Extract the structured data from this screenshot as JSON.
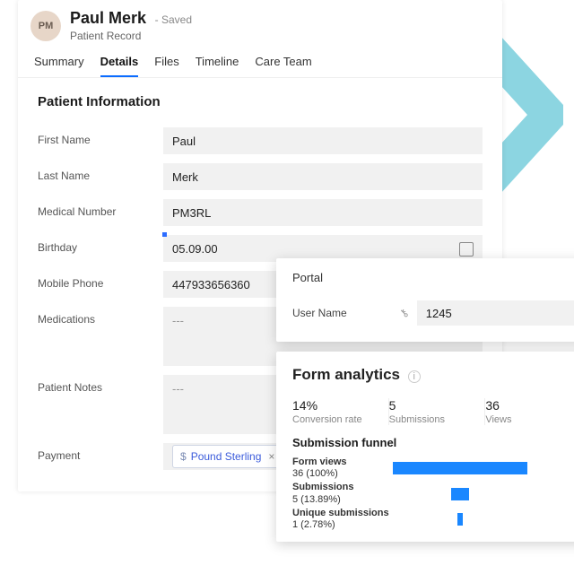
{
  "header": {
    "avatar_initials": "PM",
    "name": "Paul Merk",
    "save_status": "- Saved",
    "record_type": "Patient Record"
  },
  "tabs": [
    "Summary",
    "Details",
    "Files",
    "Timeline",
    "Care Team"
  ],
  "active_tab": 1,
  "section_title": "Patient Information",
  "fields": {
    "first_name": {
      "label": "First Name",
      "value": "Paul"
    },
    "last_name": {
      "label": "Last Name",
      "value": "Merk"
    },
    "medical_number": {
      "label": "Medical Number",
      "value": "PM3RL"
    },
    "birthday": {
      "label": "Birthday",
      "value": "05.09.00"
    },
    "mobile_phone": {
      "label": "Mobile Phone",
      "value": "447933656360"
    },
    "medications": {
      "label": "Medications",
      "value": "---"
    },
    "patient_notes": {
      "label": "Patient Notes",
      "value": "---"
    },
    "payment": {
      "label": "Payment",
      "chip": "Pound Sterling"
    }
  },
  "portal": {
    "title": "Portal",
    "username_label": "User Name",
    "username_value": "1245"
  },
  "analytics": {
    "title": "Form analytics",
    "metrics": [
      {
        "value": "14%",
        "label": "Conversion rate"
      },
      {
        "value": "5",
        "label": "Submissions"
      },
      {
        "value": "36",
        "label": "Views"
      }
    ],
    "funnel_title": "Submission funnel",
    "funnel": [
      {
        "name": "Form views",
        "detail": "36 (100%)",
        "pct": 100
      },
      {
        "name": "Submissions",
        "detail": "5 (13.89%)",
        "pct": 13.89
      },
      {
        "name": "Unique submissions",
        "detail": "1 (2.78%)",
        "pct": 2.78
      }
    ]
  },
  "chart_data": {
    "type": "bar",
    "title": "Submission funnel",
    "categories": [
      "Form views",
      "Submissions",
      "Unique submissions"
    ],
    "values": [
      36,
      5,
      1
    ],
    "percent": [
      100,
      13.89,
      2.78
    ],
    "xlabel": "",
    "ylabel": "",
    "ylim": [
      0,
      36
    ]
  }
}
